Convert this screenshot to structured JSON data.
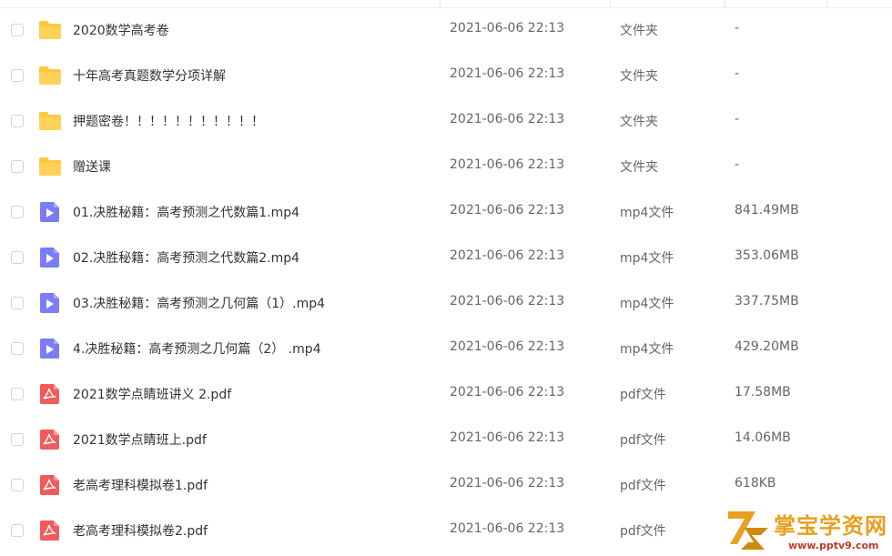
{
  "colors": {
    "folder": "#ffc83d",
    "video": "#7b7cf6",
    "pdf": "#f15b5b",
    "watermark_gold": "#e8a020",
    "watermark_red": "#c0392b"
  },
  "files": [
    {
      "name": "2020数学高考卷",
      "date": "2021-06-06 22:13",
      "type": "文件夹",
      "size": "-",
      "icon": "folder-icon"
    },
    {
      "name": "十年高考真题数学分项详解",
      "date": "2021-06-06 22:13",
      "type": "文件夹",
      "size": "-",
      "icon": "folder-icon"
    },
    {
      "name": "押题密卷！！！！！！！！！！！",
      "date": "2021-06-06 22:13",
      "type": "文件夹",
      "size": "-",
      "icon": "folder-icon"
    },
    {
      "name": "赠送课",
      "date": "2021-06-06 22:13",
      "type": "文件夹",
      "size": "-",
      "icon": "folder-icon"
    },
    {
      "name": "01.决胜秘籍：高考预测之代数篇1.mp4",
      "date": "2021-06-06 22:13",
      "type": "mp4文件",
      "size": "841.49MB",
      "icon": "video-file-icon"
    },
    {
      "name": "02.决胜秘籍：高考预测之代数篇2.mp4",
      "date": "2021-06-06 22:13",
      "type": "mp4文件",
      "size": "353.06MB",
      "icon": "video-file-icon"
    },
    {
      "name": "03.决胜秘籍：高考预测之几何篇（1）.mp4",
      "date": "2021-06-06 22:13",
      "type": "mp4文件",
      "size": "337.75MB",
      "icon": "video-file-icon"
    },
    {
      "name": "4.决胜秘籍：高考预测之几何篇（2） .mp4",
      "date": "2021-06-06 22:13",
      "type": "mp4文件",
      "size": "429.20MB",
      "icon": "video-file-icon"
    },
    {
      "name": "2021数学点睛班讲义 2.pdf",
      "date": "2021-06-06 22:13",
      "type": "pdf文件",
      "size": "17.58MB",
      "icon": "pdf-file-icon"
    },
    {
      "name": "2021数学点睛班上.pdf",
      "date": "2021-06-06 22:13",
      "type": "pdf文件",
      "size": "14.06MB",
      "icon": "pdf-file-icon"
    },
    {
      "name": "老高考理科模拟卷1.pdf",
      "date": "2021-06-06 22:13",
      "type": "pdf文件",
      "size": "618KB",
      "icon": "pdf-file-icon"
    },
    {
      "name": "老高考理科模拟卷2.pdf",
      "date": "2021-06-06 22:13",
      "type": "pdf文件",
      "size": "",
      "icon": "pdf-file-icon"
    }
  ],
  "watermark": {
    "title": "掌宝学资网",
    "url": "www.pptv9.com",
    "logo_mark": "7Z"
  }
}
